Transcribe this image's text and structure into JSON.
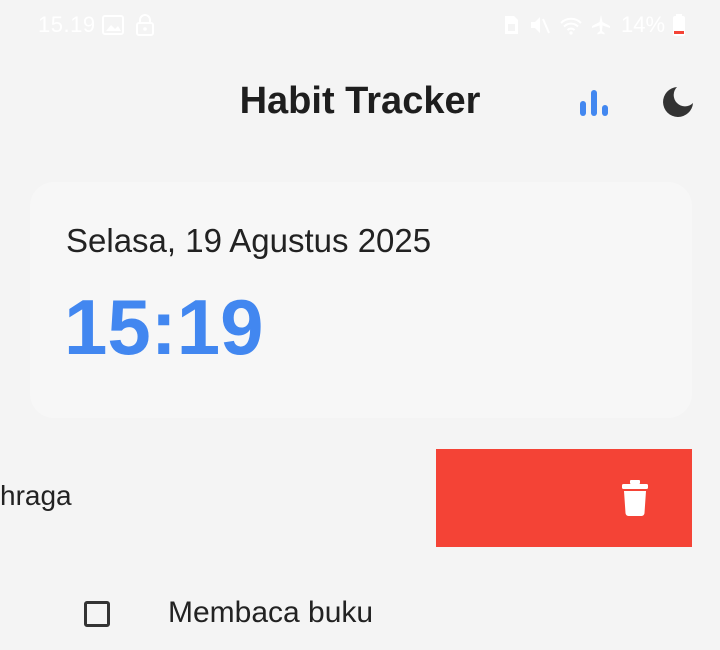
{
  "status_bar": {
    "time": "15.19",
    "battery": "14%",
    "icons": [
      "gallery-icon",
      "lock-icon",
      "sim-icon",
      "mute-icon",
      "wifi-icon",
      "airplane-icon",
      "battery-icon"
    ]
  },
  "app_bar": {
    "title": "Habit Tracker",
    "stats_icon": "bar-chart-icon",
    "theme_icon": "moon-icon"
  },
  "date_card": {
    "date": "Selasa, 19 Agustus 2025",
    "time": "15:19"
  },
  "habits": [
    {
      "label": "hraga",
      "checked": false,
      "swiped": true
    },
    {
      "label": "Membaca buku",
      "checked": false
    }
  ],
  "colors": {
    "accent": "#4287f0",
    "delete": "#f44336",
    "background": "#f4f4f4",
    "card": "#f7f7f7"
  }
}
